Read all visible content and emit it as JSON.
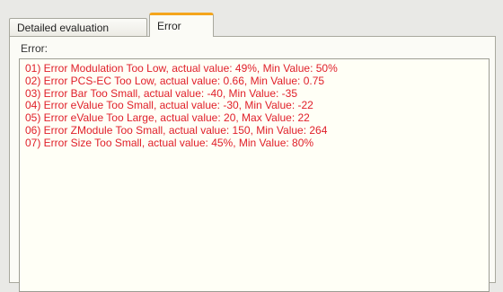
{
  "tabs": [
    {
      "label": "Detailed evaluation",
      "active": false
    },
    {
      "label": "Error",
      "active": true
    }
  ],
  "panel": {
    "label": "Error:"
  },
  "errors": [
    "01) Error  Modulation Too Low, actual value: 49%, Min Value: 50%",
    "02) Error  PCS-EC Too Low, actual value: 0.66, Min Value: 0.75",
    "03) Error  Bar Too Small, actual value: -40, Min Value: -35",
    "04) Error  eValue Too Small, actual value: -30, Min Value: -22",
    "05) Error  eValue Too Large, actual value: 20, Max Value: 22",
    "06) Error  ZModule Too Small, actual value: 150, Min Value: 264",
    "07) Error  Size Too Small, actual value: 45%, Min Value: 80%"
  ],
  "colors": {
    "error_text": "#e0202a",
    "active_tab_accent": "#f4a51c"
  }
}
